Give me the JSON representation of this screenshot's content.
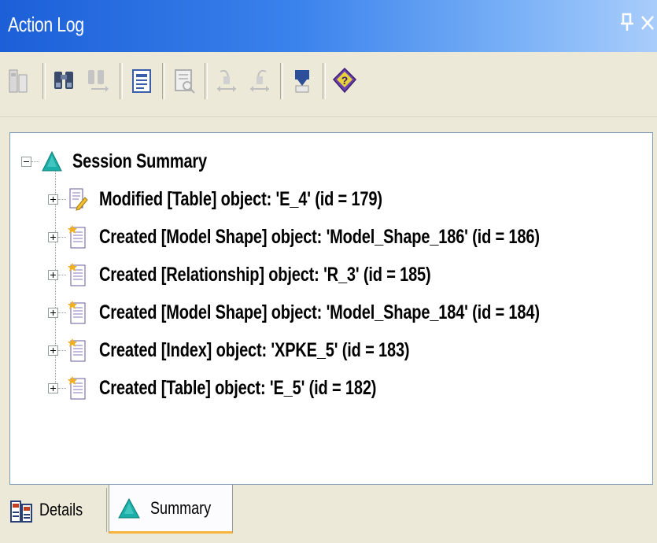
{
  "window": {
    "title": "Action Log",
    "pin_glyph": "4",
    "close_glyph": "×"
  },
  "toolbar": {
    "buttons": [
      {
        "name": "details-view-icon",
        "enabled": false
      },
      {
        "name": "find-icon",
        "enabled": true
      },
      {
        "name": "find-next-icon",
        "enabled": false
      },
      {
        "name": "properties-icon",
        "enabled": true
      },
      {
        "name": "preview-icon",
        "enabled": false
      },
      {
        "name": "undo-to-icon",
        "enabled": false
      },
      {
        "name": "redo-to-icon",
        "enabled": false
      },
      {
        "name": "filter-icon",
        "enabled": true
      },
      {
        "name": "help-icon",
        "enabled": true
      }
    ]
  },
  "tree": {
    "root": {
      "label": "Session Summary",
      "icon": "summary-triangle-icon",
      "expanded": true
    },
    "items": [
      {
        "label": "Modified [Table] object: 'E_4' (id = 179)",
        "icon": "modified-doc-icon"
      },
      {
        "label": "Created [Model Shape] object: 'Model_Shape_186' (id = 186)",
        "icon": "created-doc-icon"
      },
      {
        "label": "Created [Relationship] object: 'R_3' (id = 185)",
        "icon": "created-doc-icon"
      },
      {
        "label": "Created [Model Shape] object: 'Model_Shape_184' (id = 184)",
        "icon": "created-doc-icon"
      },
      {
        "label": "Created [Index] object: 'XPKE_5' (id = 183)",
        "icon": "created-doc-icon"
      },
      {
        "label": "Created [Table] object: 'E_5' (id = 182)",
        "icon": "created-doc-icon"
      }
    ]
  },
  "tabs": [
    {
      "label": "Details",
      "icon": "details-tab-icon",
      "active": false
    },
    {
      "label": "Summary",
      "icon": "summary-triangle-icon",
      "active": true
    }
  ],
  "colors": {
    "title_gradient_start": "#1c5fd8",
    "title_gradient_end": "#a9cdfb",
    "panel_bg": "#ece9d8",
    "active_tab_accent": "#f8b43c",
    "triangle_teal": "#1aaea8"
  }
}
